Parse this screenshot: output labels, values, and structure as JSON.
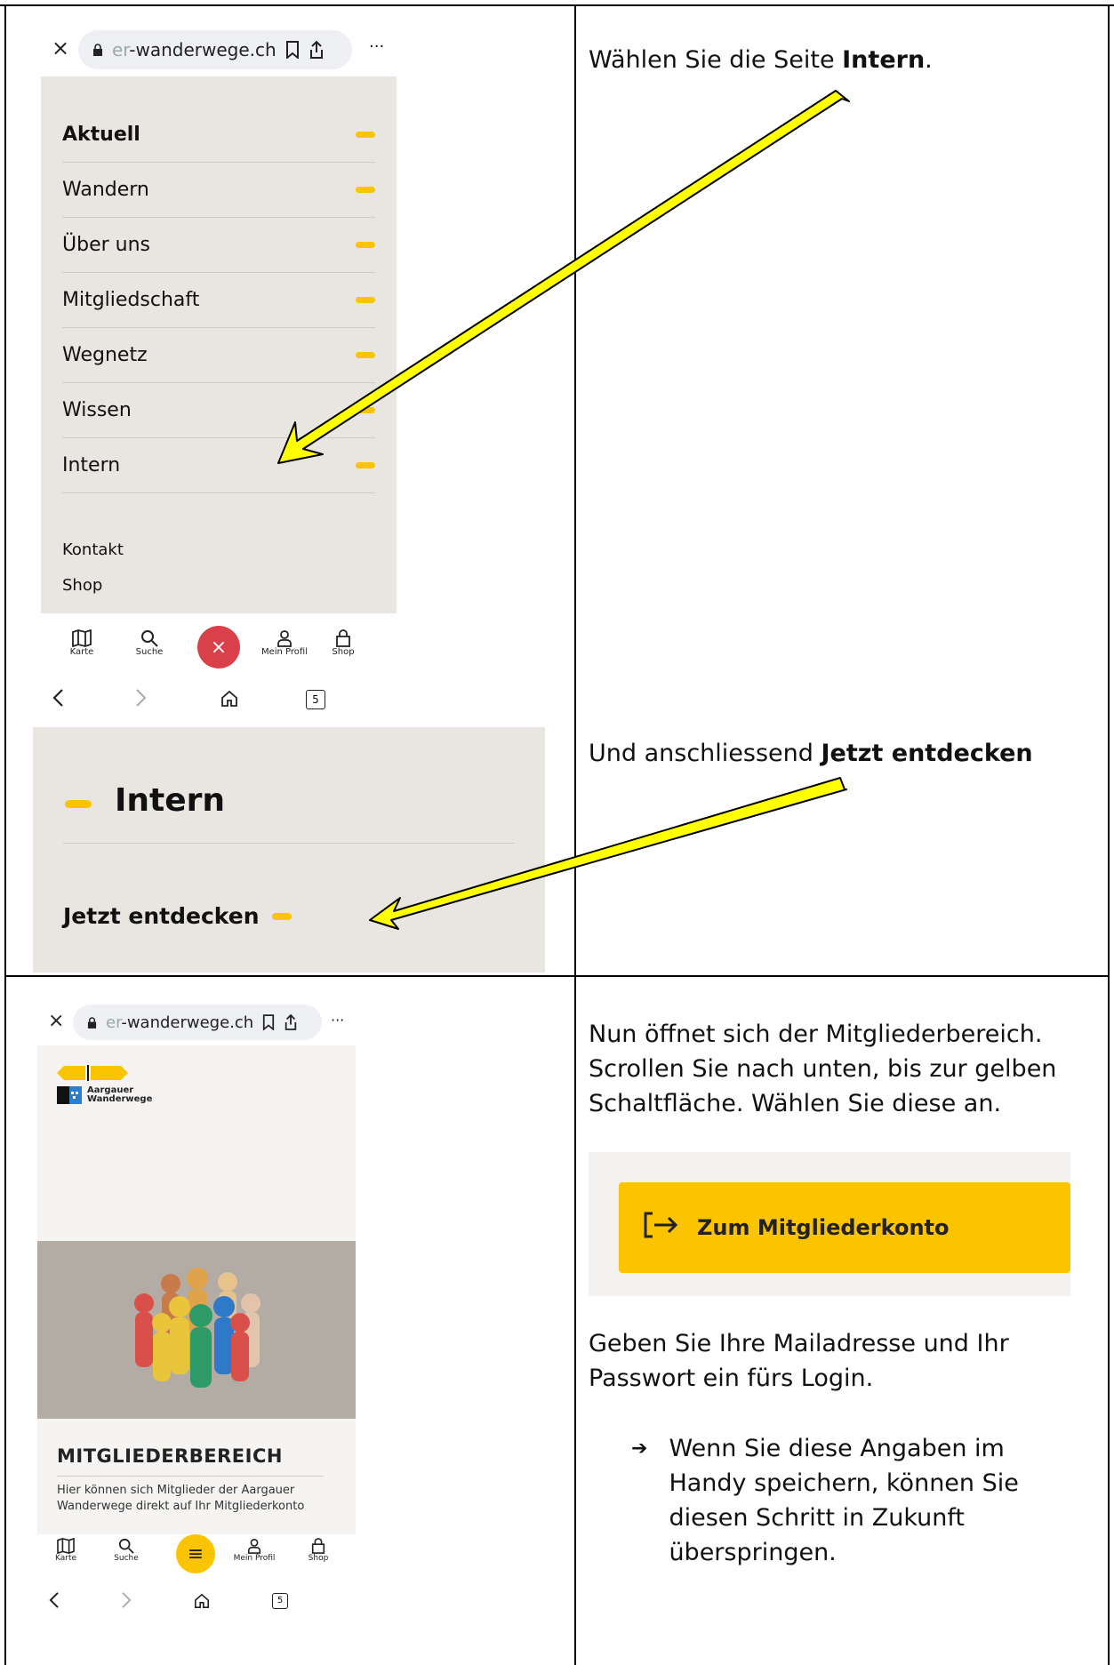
{
  "step1": {
    "instruction_prefix": "Wählen Sie die Seite ",
    "instruction_bold": "Intern",
    "instruction_suffix": ".",
    "browser": {
      "close": "×",
      "url_faded": "er",
      "url_main": "-wanderwege.ch",
      "more": "···"
    },
    "menu_items": [
      "Aktuell",
      "Wandern",
      "Über uns",
      "Mitgliedschaft",
      "Wegnetz",
      "Wissen",
      "Intern"
    ],
    "secondary_links": [
      "Kontakt",
      "Shop"
    ],
    "bottom_nav": {
      "karte": "Karte",
      "suche": "Suche",
      "close": "×",
      "profil": "Mein Profil",
      "shop": "Shop"
    },
    "tab_count": "5"
  },
  "step2": {
    "instruction_prefix": "Und anschliessend ",
    "instruction_bold": "Jetzt entdecken",
    "heading": "Intern",
    "link": "Jetzt entdecken"
  },
  "step3": {
    "paragraph1": "Nun öffnet sich der Mitgliederbereich. Scrollen Sie nach unten, bis zur gelben Schaltfläche. Wählen Sie diese an.",
    "button_label": "Zum Mitgliederkonto",
    "paragraph2": "Geben Sie Ihre Mailadresse und Ihr Passwort ein fürs Login.",
    "bullet_arrow": "➔",
    "bullet_text": "Wenn Sie diese Angaben im Handy speichern, können Sie diesen Schritt in Zukunft überspringen.",
    "browser": {
      "close": "×",
      "url_faded": "er",
      "url_main": "-wanderwege.ch",
      "more": "···"
    },
    "logo_line1": "Aargauer",
    "logo_line2": "Wanderwege",
    "page_title": "MITGLIEDERBEREICH",
    "page_desc": "Hier können sich Mitglieder der Aargauer Wanderwege direkt auf Ihr Mitgliederkonto",
    "bottom_nav": {
      "karte": "Karte",
      "suche": "Suche",
      "menu": "≡",
      "profil": "Mein Profil",
      "shop": "Shop"
    },
    "tab_count": "5"
  },
  "colors": {
    "accent_yellow": "#fbc400",
    "close_red": "#d9404a",
    "panel_beige": "#e9e6e1",
    "arrow_yellow": "#ffff00"
  }
}
